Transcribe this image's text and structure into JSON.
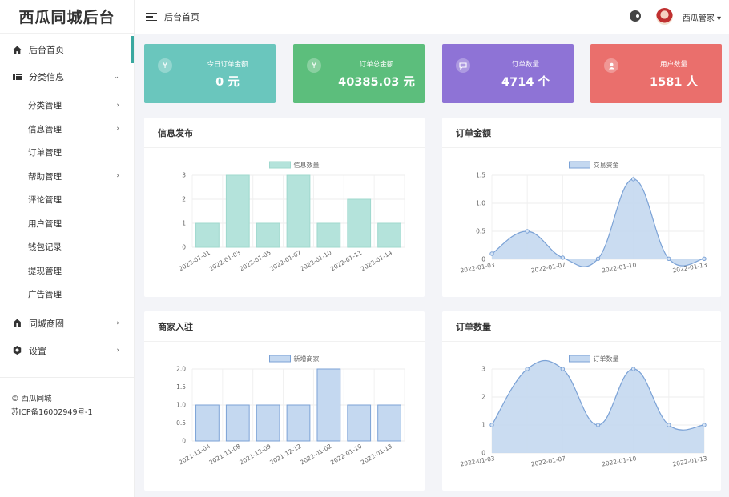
{
  "sidebar": {
    "logo": "西瓜同城后台",
    "nav_home": "后台首页",
    "nav_category": "分类信息",
    "sub_items": [
      {
        "label": "分类管理",
        "has_arrow": true
      },
      {
        "label": "信息管理",
        "has_arrow": true
      },
      {
        "label": "订单管理",
        "has_arrow": false
      },
      {
        "label": "帮助管理",
        "has_arrow": true
      },
      {
        "label": "评论管理",
        "has_arrow": false
      },
      {
        "label": "用户管理",
        "has_arrow": false
      },
      {
        "label": "钱包记录",
        "has_arrow": false
      },
      {
        "label": "提现管理",
        "has_arrow": false
      },
      {
        "label": "广告管理",
        "has_arrow": false
      }
    ],
    "nav_mall": "同城商圈",
    "nav_settings": "设置",
    "copyright": "© 西瓜同城",
    "icp": "苏ICP备16002949号-1"
  },
  "header": {
    "title": "后台首页",
    "user_name": "西瓜管家 ▾"
  },
  "stats": [
    {
      "label": "今日订单金额",
      "value": "0 元",
      "icon": "yuan-icon",
      "color": "#6ac6bd"
    },
    {
      "label": "订单总金额",
      "value": "40385.03 元",
      "icon": "yuan-icon",
      "color": "#5cbe7c"
    },
    {
      "label": "订单数量",
      "value": "4714 个",
      "icon": "message-icon",
      "color": "#8e73d6"
    },
    {
      "label": "用户数量",
      "value": "1581 人",
      "icon": "user-icon",
      "color": "#ea6f6c"
    }
  ],
  "panels": {
    "info": "信息发布",
    "amount": "订单金额",
    "merchant": "商家入驻",
    "orders": "订单数量"
  },
  "chart_data": [
    {
      "type": "bar",
      "title": "信息发布",
      "categories": [
        "2022-01-01",
        "2022-01-03",
        "2022-01-05",
        "2022-01-07",
        "2022-01-10",
        "2022-01-11",
        "2022-01-14"
      ],
      "series": [
        {
          "name": "信息数量",
          "values": [
            1,
            3,
            1,
            3,
            1,
            2,
            1
          ]
        }
      ],
      "yticks": [
        "0",
        "1",
        "2",
        "3"
      ],
      "ylim": [
        0,
        3
      ],
      "color": "#b4e3db",
      "stroke": "#9fd8ce"
    },
    {
      "type": "area",
      "title": "订单金额",
      "categories": [
        "2022-01-03",
        "2022-01-05",
        "2022-01-07",
        "2022-01-09",
        "2022-01-10",
        "2022-01-12",
        "2022-01-13"
      ],
      "xticks": [
        "2022-01-03",
        "2022-01-07",
        "2022-01-10",
        "2022-01-13"
      ],
      "series": [
        {
          "name": "交易资金",
          "values": [
            0.1,
            0.5,
            0.03,
            0.01,
            1.43,
            0.01,
            0.01
          ]
        }
      ],
      "yticks": [
        "0",
        "0.5",
        "1.0",
        "1.5"
      ],
      "ylim": [
        0,
        1.5
      ],
      "color": "#c4d8f0",
      "stroke": "#7ba2d6"
    },
    {
      "type": "bar",
      "title": "商家入驻",
      "categories": [
        "2021-11-04",
        "2021-11-08",
        "2021-12-09",
        "2021-12-12",
        "2022-01-02",
        "2022-01-10",
        "2022-01-13"
      ],
      "series": [
        {
          "name": "新增商家",
          "values": [
            1,
            1,
            1,
            1,
            2,
            1,
            1
          ]
        }
      ],
      "yticks": [
        "0",
        "0.5",
        "1.0",
        "1.5",
        "2.0"
      ],
      "ylim": [
        0,
        2
      ],
      "color": "#c4d8f0",
      "stroke": "#7ba2d6"
    },
    {
      "type": "area",
      "title": "订单数量",
      "categories": [
        "2022-01-03",
        "2022-01-05",
        "2022-01-07",
        "2022-01-09",
        "2022-01-10",
        "2022-01-12",
        "2022-01-13"
      ],
      "xticks": [
        "2022-01-03",
        "2022-01-07",
        "2022-01-10",
        "2022-01-13"
      ],
      "series": [
        {
          "name": "订单数量",
          "values": [
            1,
            3,
            3,
            1,
            3,
            1,
            1
          ]
        }
      ],
      "yticks": [
        "0",
        "1",
        "2",
        "3"
      ],
      "ylim": [
        0,
        3
      ],
      "color": "#c4d8f0",
      "stroke": "#7ba2d6"
    }
  ]
}
